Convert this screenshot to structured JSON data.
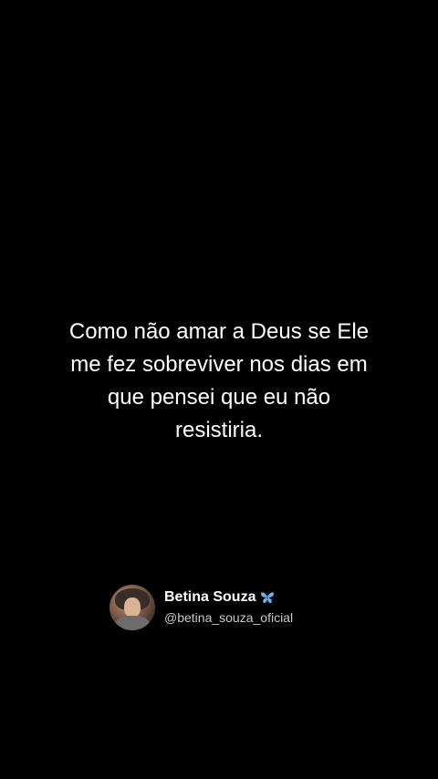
{
  "post": {
    "quote_lines": [
      "Como não amar a Deus se Ele",
      "me fez sobreviver nos dias em",
      "que pensei que eu não",
      "resistiria."
    ]
  },
  "author": {
    "name": "Betina Souza",
    "handle": "@betina_souza_oficial",
    "badge_icon": "butterfly-icon"
  },
  "colors": {
    "background": "#000000",
    "text": "#ffffff",
    "handle": "#c9c9c9",
    "badge": "#6fb3ea"
  }
}
